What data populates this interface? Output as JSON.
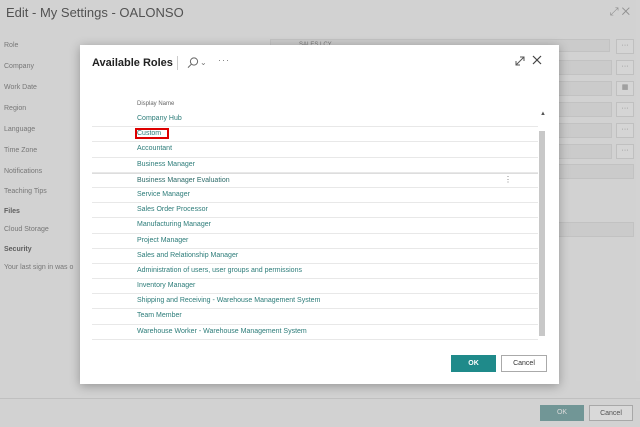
{
  "page": {
    "title": "Edit - My Settings - OALONSO",
    "fields": [
      {
        "label": "Role",
        "value": "SALES LCY"
      },
      {
        "label": "Company",
        "value": ""
      },
      {
        "label": "Work Date",
        "value": ""
      },
      {
        "label": "Region",
        "value": ""
      },
      {
        "label": "Language",
        "value": ""
      },
      {
        "label": "Time Zone",
        "value": ""
      },
      {
        "label": "Notifications",
        "value": ""
      },
      {
        "label": "Teaching Tips",
        "value": ""
      }
    ],
    "files_section": "Files",
    "cloud_storage_label": "Cloud Storage",
    "security_section": "Security",
    "last_signin": "Your last sign in was o",
    "ok_label": "OK",
    "cancel_label": "Cancel"
  },
  "dialog": {
    "title": "Available Roles",
    "column_header": "Display Name",
    "rows": [
      "Company Hub",
      "Custom",
      "Accountant",
      "Business Manager",
      "Business Manager Evaluation",
      "Service Manager",
      "Sales Order Processor",
      "Manufacturing Manager",
      "Project Manager",
      "Sales and Relationship Manager",
      "Administration of users, user groups and permissions",
      "Inventory Manager",
      "Shipping and Receiving - Warehouse Management System",
      "Team Member",
      "Warehouse Worker - Warehouse Management System"
    ],
    "ok_label": "OK",
    "cancel_label": "Cancel"
  },
  "colors": {
    "accent": "#1f8a8a",
    "link": "#2c7c79",
    "highlight": "#dd0000"
  }
}
